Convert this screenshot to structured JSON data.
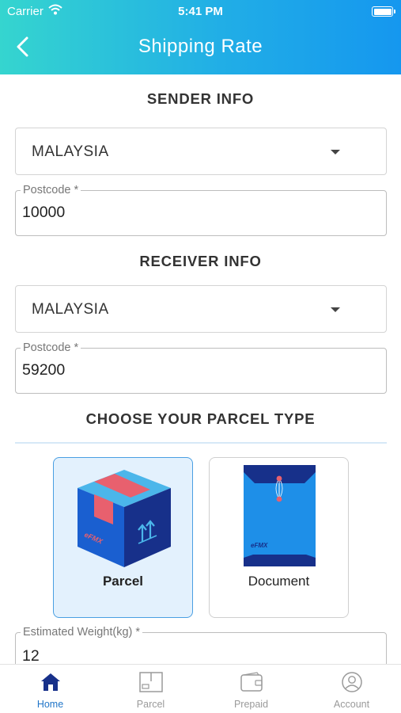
{
  "status_bar": {
    "carrier": "Carrier",
    "time": "5:41 PM"
  },
  "header": {
    "title": "Shipping Rate"
  },
  "sender": {
    "heading": "SENDER INFO",
    "country": "MALAYSIA",
    "postcode_label": "Postcode *",
    "postcode_value": "10000"
  },
  "receiver": {
    "heading": "RECEIVER INFO",
    "country": "MALAYSIA",
    "postcode_label": "Postcode *",
    "postcode_value": "59200"
  },
  "parcel_type": {
    "heading": "CHOOSE YOUR PARCEL TYPE",
    "options": [
      {
        "label": "Parcel",
        "selected": true,
        "icon": "parcel-box-icon"
      },
      {
        "label": "Document",
        "selected": false,
        "icon": "document-envelope-icon"
      }
    ]
  },
  "weight": {
    "label": "Estimated Weight(kg) *",
    "value": "12"
  },
  "tabs": [
    {
      "label": "Home",
      "active": true,
      "icon": "home-icon"
    },
    {
      "label": "Parcel",
      "active": false,
      "icon": "parcel-icon"
    },
    {
      "label": "Prepaid",
      "active": false,
      "icon": "wallet-icon"
    },
    {
      "label": "Account",
      "active": false,
      "icon": "account-icon"
    }
  ],
  "colors": {
    "header_gradient_start": "#35d5cf",
    "header_gradient_end": "#1597ef",
    "accent": "#2075c8",
    "selected_card_bg": "#e3f1fd",
    "box_red": "#e8606e",
    "envelope_blue": "#1e8fe8"
  }
}
